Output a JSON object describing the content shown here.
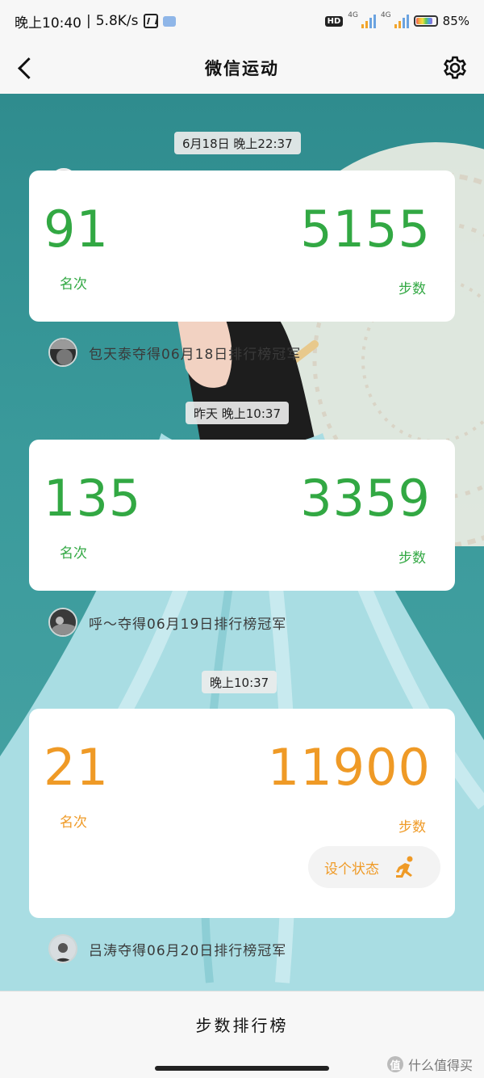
{
  "status_bar": {
    "time": "晚上10:40",
    "speed": "5.8K/s",
    "network_1": "4G",
    "network_2": "4G",
    "battery": "85%"
  },
  "header": {
    "title": "微信运动"
  },
  "entries": [
    {
      "time": "6月18日 晚上22:37",
      "rank": "91",
      "rank_label": "名次",
      "steps": "5155",
      "steps_label": "步数",
      "champion": "包天泰夺得06月18日排行榜冠军"
    },
    {
      "time": "昨天 晚上10:37",
      "rank": "135",
      "rank_label": "名次",
      "steps": "3359",
      "steps_label": "步数",
      "champion": "呼～夺得06月19日排行榜冠军"
    },
    {
      "time": "晚上10:37",
      "rank": "21",
      "rank_label": "名次",
      "steps": "11900",
      "steps_label": "步数",
      "status_button": "设个状态",
      "champion": "吕涛夺得06月20日排行榜冠军"
    }
  ],
  "bottom": {
    "leaderboard": "步数排行榜",
    "watermark": "什么值得买",
    "watermark_logo": "值"
  },
  "colors": {
    "green": "#32a843",
    "orange": "#ef9a26",
    "teal_background": "#3a9a9b"
  }
}
